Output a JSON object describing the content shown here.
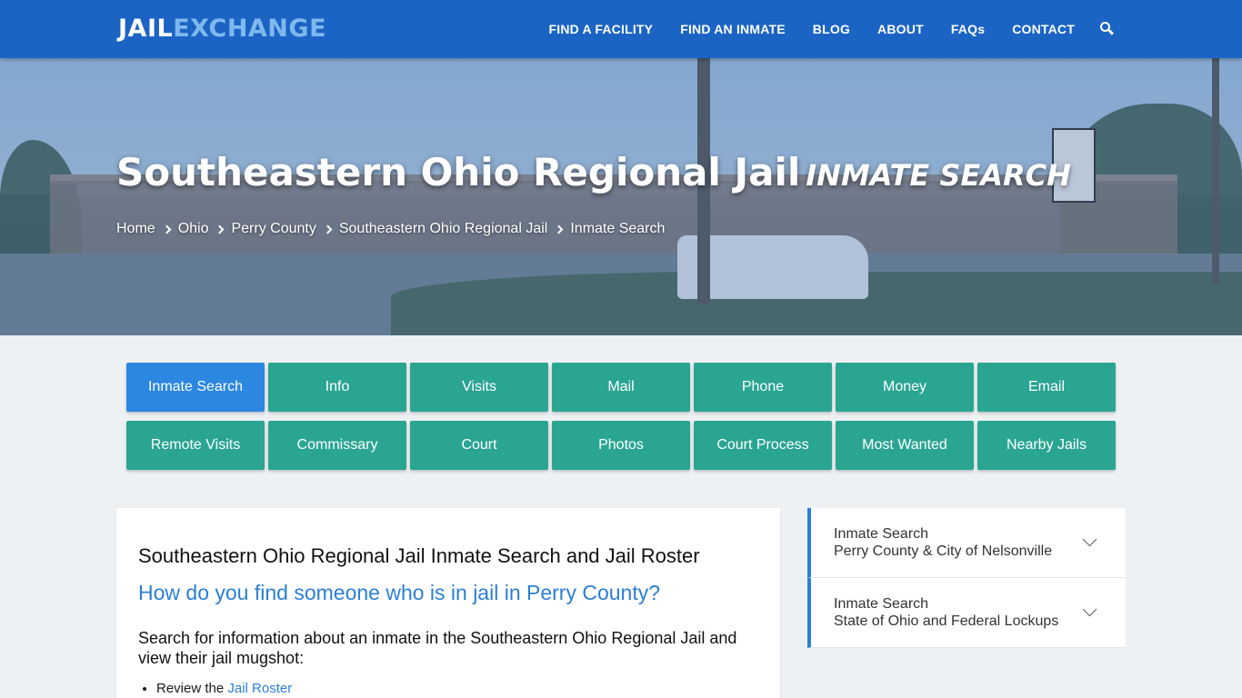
{
  "header": {
    "logo_part1": "JAIL",
    "logo_part2": "EXCHANGE",
    "nav": [
      "FIND A FACILITY",
      "FIND AN INMATE",
      "BLOG",
      "ABOUT",
      "FAQs",
      "CONTACT"
    ]
  },
  "hero": {
    "title": "Southeastern Ohio Regional Jail",
    "subtitle": "Inmate Search",
    "breadcrumb": [
      "Home",
      "Ohio",
      "Perry County",
      "Southeastern Ohio Regional Jail",
      "Inmate Search"
    ]
  },
  "buttons": [
    "Inmate Search",
    "Info",
    "Visits",
    "Mail",
    "Phone",
    "Money",
    "Email",
    "Remote Visits",
    "Commissary",
    "Court",
    "Photos",
    "Court Process",
    "Most Wanted",
    "Nearby Jails"
  ],
  "active_button": "Inmate Search",
  "main": {
    "heading": "Southeastern Ohio Regional Jail Inmate Search and Jail Roster",
    "question": "How do you find someone who is in jail in Perry County?",
    "intro": "Search for information about an inmate in the Southeastern Ohio Regional Jail and view their jail mugshot:",
    "list_item_prefix": "Review the",
    "list_item_link": "Jail Roster"
  },
  "sidebar": [
    {
      "line1": "Inmate Search",
      "line2": "Perry County & City of Nelsonville"
    },
    {
      "line1": "Inmate Search",
      "line2": "State of Ohio and Federal Lockups"
    }
  ],
  "colors": {
    "header_bg": "#1b64c4",
    "button_bg": "#2aa592",
    "button_active": "#2b87e0",
    "link": "#2b7fd4"
  }
}
